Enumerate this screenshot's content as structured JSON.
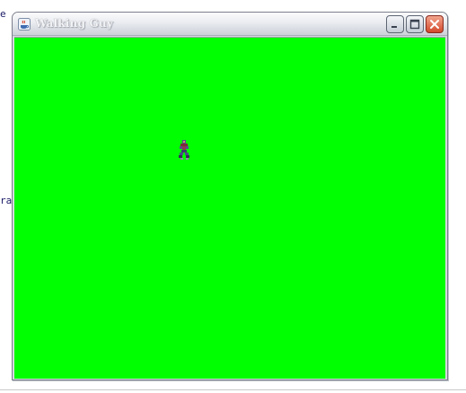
{
  "window": {
    "title": "Walking Guy",
    "icon": "java-cup-icon"
  },
  "titlebar_buttons": {
    "minimize_icon": "minimize-icon",
    "maximize_icon": "maximize-icon",
    "close_icon": "close-icon"
  },
  "canvas": {
    "background_color": "#00ff00"
  },
  "sprite": {
    "icon": "walking-guy-sprite"
  },
  "background_text": {
    "fragment_1": "e",
    "fragment_2": "ra"
  }
}
